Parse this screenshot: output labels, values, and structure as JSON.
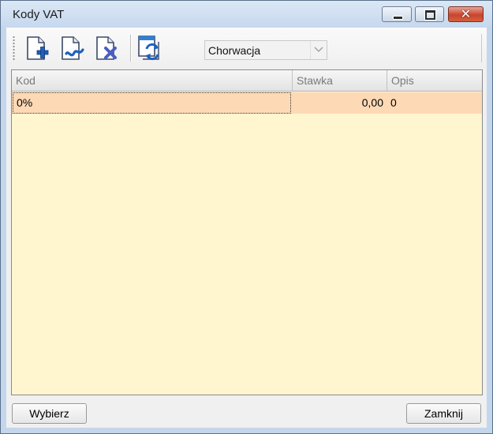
{
  "window": {
    "title": "Kody VAT"
  },
  "toolbar": {
    "buttons": [
      {
        "icon": "add-document-icon"
      },
      {
        "icon": "edit-document-icon"
      },
      {
        "icon": "delete-document-icon"
      },
      {
        "icon": "refresh-icon"
      }
    ],
    "country_select": {
      "value": "Chorwacja"
    }
  },
  "grid": {
    "columns": [
      "Kod",
      "Stawka",
      "Opis"
    ],
    "rows": [
      {
        "kod": "0%",
        "stawka": "0,00",
        "opis": "0"
      }
    ],
    "colors": {
      "background": "#fff6cf",
      "selected_row": "#fed9b6"
    }
  },
  "footer": {
    "select_label": "Wybierz",
    "close_label": "Zamknij"
  }
}
